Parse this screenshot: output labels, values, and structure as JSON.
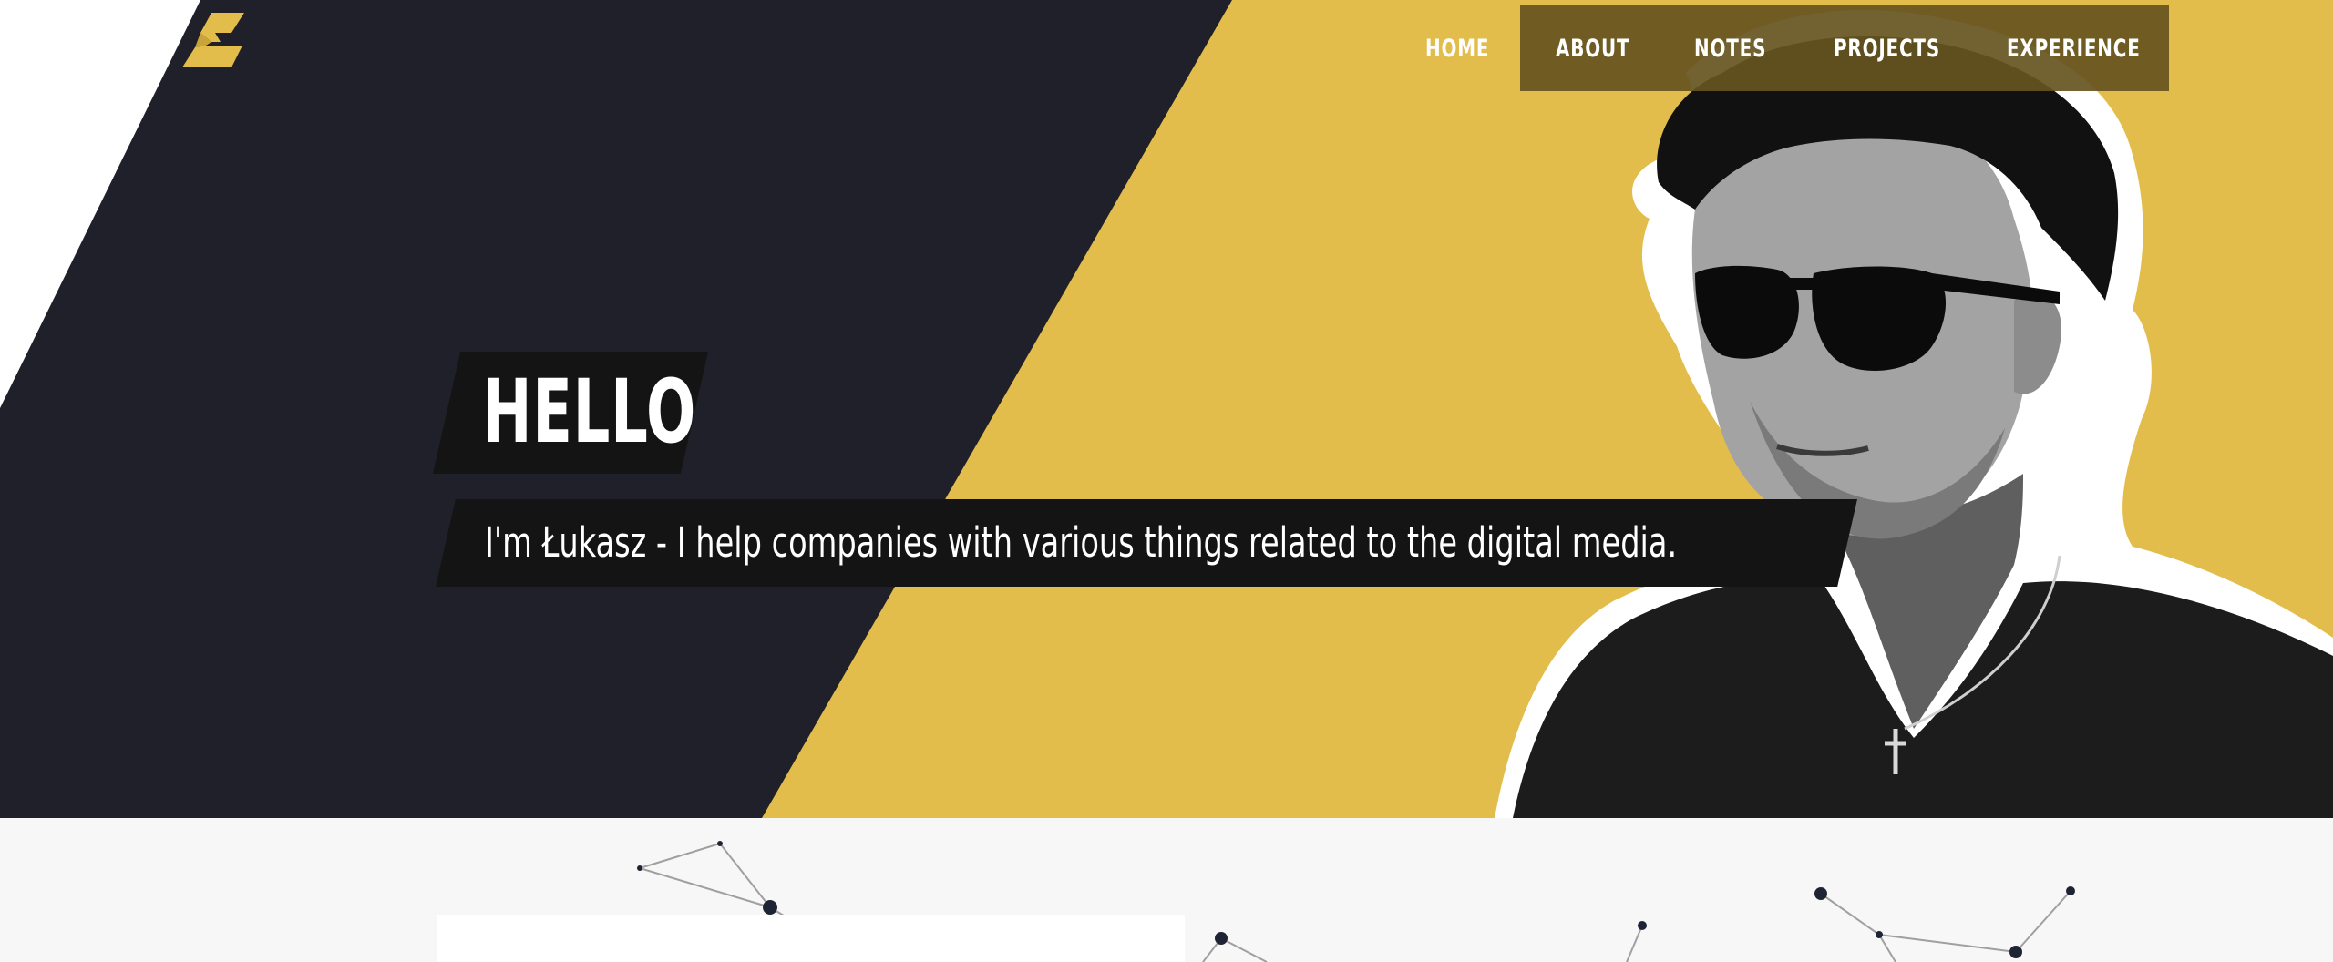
{
  "brand": {
    "logo_icon": "stylized-zigzag-logo",
    "colors": {
      "dark": "#1f2029",
      "accent": "#e2bd4b",
      "nav_bg": "#665420",
      "text_box": "#141414",
      "section_bg": "#f7f7f7"
    }
  },
  "nav": {
    "items": [
      {
        "label": "HOME"
      },
      {
        "label": "ABOUT"
      },
      {
        "label": "NOTES"
      },
      {
        "label": "PROJECTS"
      },
      {
        "label": "EXPERIENCE"
      }
    ]
  },
  "hero": {
    "greeting": "HELLO",
    "tagline": "I'm Łukasz - I help companies with various things related to the digital media.",
    "portrait_icon": "person-portrait-photo"
  },
  "below": {
    "decoration_icon": "network-nodes-pattern"
  }
}
